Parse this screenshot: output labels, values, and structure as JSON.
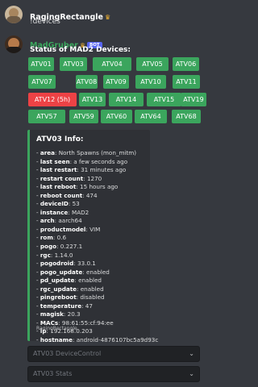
{
  "messages": [
    {
      "username": "RagingRectangle",
      "badge_icon": "crown-icon",
      "text": "!devices"
    },
    {
      "username": "MadGruber",
      "badge_icon": "crown-icon",
      "bot_tag": "BOT",
      "title": "Status of MAD2 Devices:"
    }
  ],
  "device_buttons": [
    {
      "label": "ATV01",
      "status": "online"
    },
    {
      "label": "ATV03",
      "status": "online"
    },
    {
      "label": "ATV04",
      "status": "online"
    },
    {
      "label": "ATV05",
      "status": "online"
    },
    {
      "label": "ATV06",
      "status": "online"
    },
    {
      "label": "ATV07",
      "status": "online"
    },
    {
      "label": "ATV08",
      "status": "online"
    },
    {
      "label": "ATV09",
      "status": "online"
    },
    {
      "label": "ATV10",
      "status": "online"
    },
    {
      "label": "ATV11",
      "status": "online"
    },
    {
      "label": "ATV12 (5h)",
      "status": "offline"
    },
    {
      "label": "ATV13",
      "status": "online"
    },
    {
      "label": "ATV14",
      "status": "online"
    },
    {
      "label": "ATV15",
      "status": "online"
    },
    {
      "label": "ATV19",
      "status": "online"
    },
    {
      "label": "ATV57",
      "status": "online"
    },
    {
      "label": "ATV59",
      "status": "online"
    },
    {
      "label": "ATV60",
      "status": "online"
    },
    {
      "label": "ATV64",
      "status": "online"
    },
    {
      "label": "ATV68",
      "status": "online"
    }
  ],
  "embed": {
    "title": "ATV03 Info:",
    "fields": [
      {
        "key": "area",
        "value": "North Spawns (mon_mitm)"
      },
      {
        "key": "last seen",
        "value": "a few seconds ago"
      },
      {
        "key": "last restart",
        "value": "31 minutes ago"
      },
      {
        "key": "restart count",
        "value": "1270"
      },
      {
        "key": "last reboot",
        "value": "15 hours ago"
      },
      {
        "key": "reboot count",
        "value": "474"
      },
      {
        "key": "deviceID",
        "value": "53"
      },
      {
        "key": "instance",
        "value": "MAD2"
      },
      {
        "key": "arch",
        "value": "aarch64"
      },
      {
        "key": "productmodel",
        "value": "VIM"
      },
      {
        "key": "rom",
        "value": "0.6"
      },
      {
        "key": "pogo",
        "value": "0.227.1"
      },
      {
        "key": "rgc",
        "value": "1.14.0"
      },
      {
        "key": "pogodroid",
        "value": "33.0.1"
      },
      {
        "key": "pogo_update",
        "value": "enabled"
      },
      {
        "key": "pd_update",
        "value": "enabled"
      },
      {
        "key": "rgc_update",
        "value": "enabled"
      },
      {
        "key": "pingreboot",
        "value": "disabled"
      },
      {
        "key": "temperature",
        "value": "47"
      },
      {
        "key": "magisk",
        "value": "20.3"
      },
      {
        "key": "MACs",
        "value": "98:61:55:cf:94:ee"
      },
      {
        "key": "ip",
        "value": "192.168.0.203"
      },
      {
        "key": "hostname",
        "value": "android-4876107bc5a9d93c"
      }
    ],
    "footer": "RagingRectangle"
  },
  "selects": [
    {
      "placeholder": "ATV03 DeviceControl"
    },
    {
      "placeholder": "ATV03 Stats"
    }
  ],
  "colors": {
    "online": "#3ba55d",
    "offline": "#ed4245",
    "accent": "#5865f2"
  }
}
